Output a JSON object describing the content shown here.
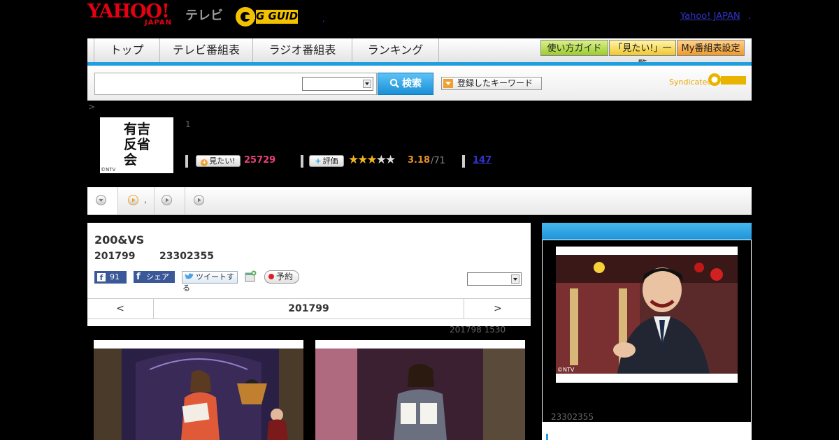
{
  "header": {
    "logo_yahoo": "YAHOO!",
    "logo_japan": "JAPAN",
    "logo_tv": "テレビ",
    "logo_gguide": "G GUIDE",
    "yahoo_japan_link": "Yahoo! JAPAN",
    "dot_left": ",",
    "dot_right": "."
  },
  "nav": {
    "tabs": [
      "トップ",
      "テレビ番組表",
      "ラジオ番組表",
      "ランキング"
    ],
    "buttons": [
      "使い方ガイド",
      "「見たい!」一覧",
      "My番組表設定"
    ]
  },
  "search": {
    "input_value": "",
    "select_value": "",
    "button_label": "検索",
    "keyword_button": "登録したキーワード",
    "syndicated": "Syndicated"
  },
  "program": {
    "breadcrumb": ">",
    "thumb_credit": "©NTV",
    "thumb_caption": "有吉反省会",
    "episode_no": "1",
    "mitai_label": "見たい!",
    "mitai_count": "25729",
    "hyoka_label": "評価",
    "rating": "3.18",
    "rating_count": "/71",
    "comment_count": "147"
  },
  "subtabs": {
    "tab2_text": ","
  },
  "main": {
    "title": "200&VS",
    "date": "201799",
    "time": "23302355",
    "fb_count": "91",
    "fb_share": "シェア",
    "tweet": "ツイートする",
    "reserve": "予約",
    "pager_prev": "<",
    "pager_current": "201799",
    "pager_next": ">",
    "broadcast_info": "201798  1530"
  },
  "sidebar": {
    "photo_credit": "©NTV",
    "time": "23302355"
  },
  "colors": {
    "accent_blue": "#1f9fe0",
    "yahoo_red": "#e60012",
    "pink_count": "#e8407a",
    "rating_orange": "#e8902a"
  }
}
